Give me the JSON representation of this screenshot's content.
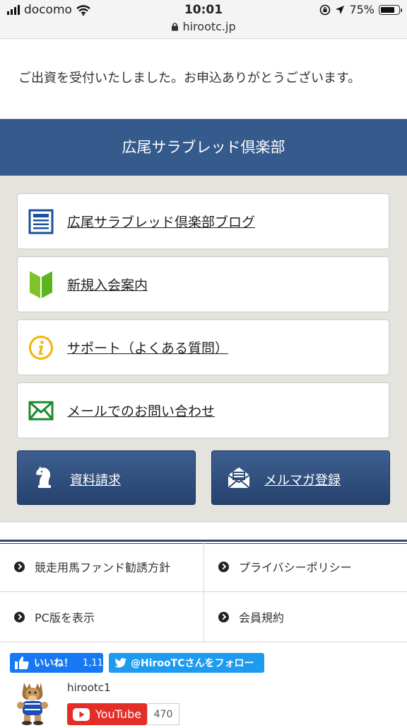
{
  "status_bar": {
    "carrier": "docomo",
    "time": "10:01",
    "battery": "75%",
    "url": "hirootc.jp"
  },
  "message": "ご出資を受付いたしました。お申込ありがとうございます。",
  "banner_title": "広尾サラブレッド倶楽部",
  "menu_items": [
    {
      "label": "広尾サラブレッド倶楽部ブログ",
      "icon": "document-icon"
    },
    {
      "label": "新規入会案内",
      "icon": "beginner-mark-icon"
    },
    {
      "label": "サポート（よくある質問）",
      "icon": "info-icon"
    },
    {
      "label": "メールでのお問い合わせ",
      "icon": "mail-icon"
    }
  ],
  "buttons": [
    {
      "label": "資料請求",
      "icon": "knight-chess-icon"
    },
    {
      "label": "メルマガ登録",
      "icon": "newsletter-envelope-icon"
    }
  ],
  "footer_links": [
    {
      "label": "競走用馬ファンド勧誘方針"
    },
    {
      "label": "プライバシーポリシー"
    },
    {
      "label": "PC版を表示"
    },
    {
      "label": "会員規約"
    }
  ],
  "social": {
    "facebook_label": "いいね！",
    "facebook_count": "1,11",
    "twitter_label": "@HirooTCさんをフォロー",
    "channel_name": "hirootc1",
    "youtube_label": "YouTube",
    "youtube_count": "470"
  },
  "colors": {
    "banner": "#355a8c",
    "button": "#2f4d7c",
    "menu_background": "#e5e3de",
    "facebook": "#1877f2",
    "twitter": "#1d9bf0",
    "youtube": "#e52d27"
  }
}
